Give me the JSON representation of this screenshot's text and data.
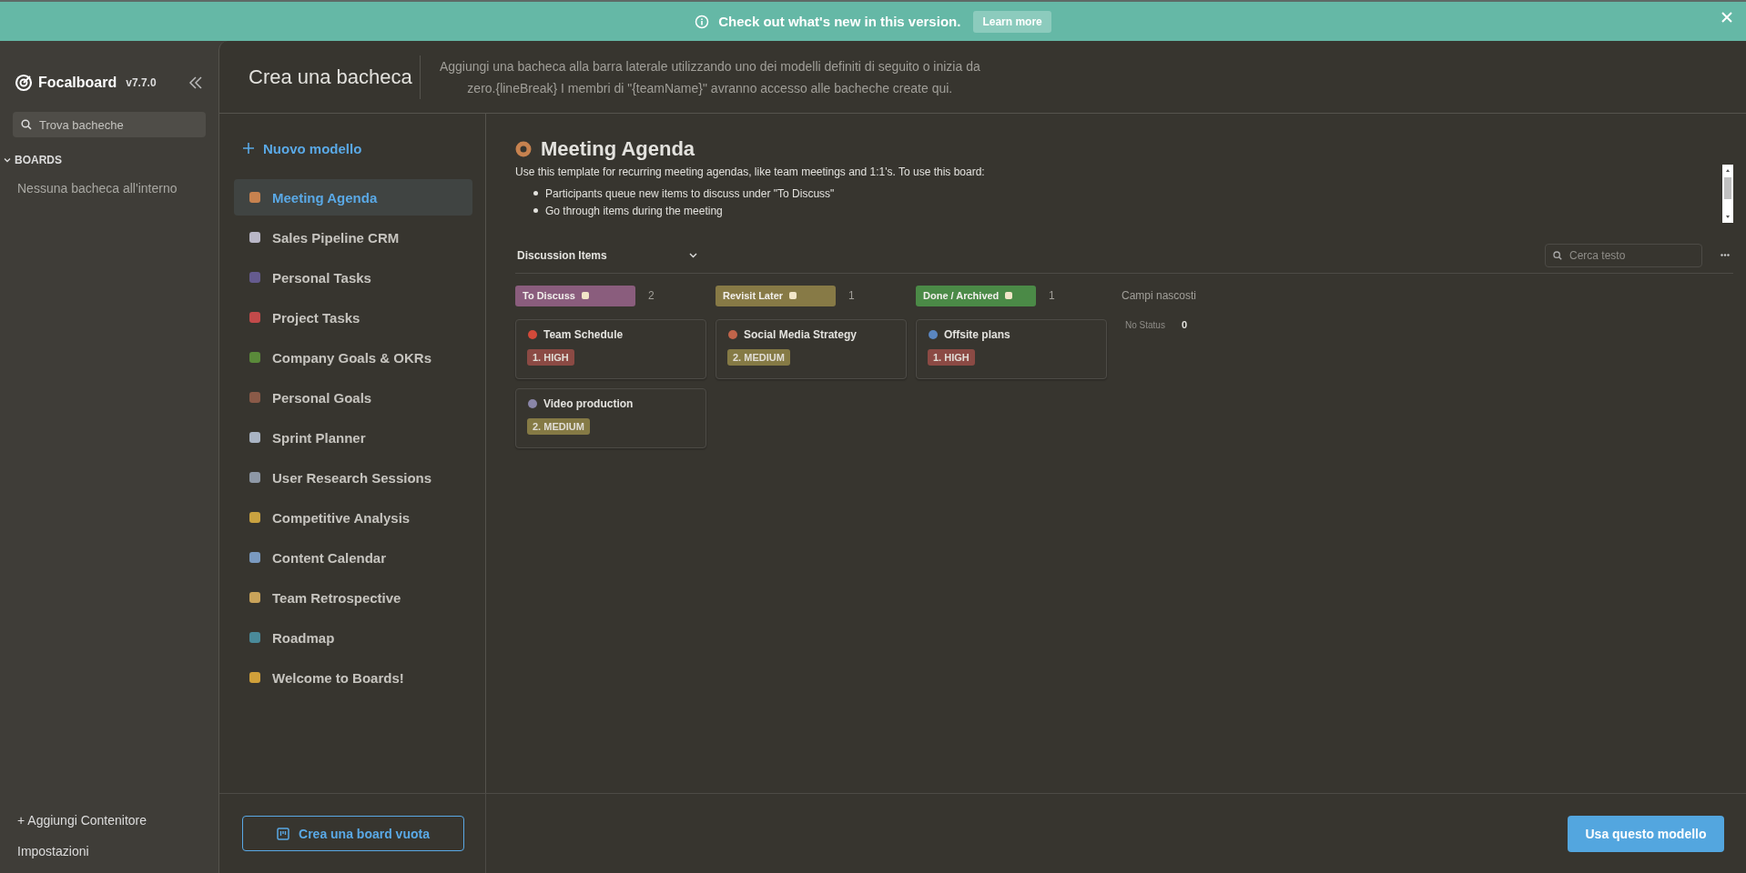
{
  "banner": {
    "message": "Check out what's new in this version.",
    "link": "Learn more"
  },
  "sidebar": {
    "app_name": "Focalboard",
    "version": "v7.7.0",
    "search": {
      "placeholder": "Trova bacheche"
    },
    "section": {
      "label": "BOARDS",
      "expanded": true
    },
    "empty": "Nessuna bacheca all'interno",
    "add": "+ Aggiungi Contenitore",
    "settings": "Impostazioni"
  },
  "dialog": {
    "title": "Crea una bacheca",
    "description": "Aggiungi una bacheca alla barra laterale utilizzando uno dei modelli definiti di seguito o inizia da zero.{lineBreak} I membri di \"{teamName}\" avranno accesso alle bacheche create qui.",
    "new_template": "Nuovo modello",
    "templates": [
      {
        "label": "Meeting Agenda",
        "selected": true
      },
      {
        "label": "Sales Pipeline CRM",
        "selected": false
      },
      {
        "label": "Personal Tasks",
        "selected": false
      },
      {
        "label": "Project Tasks",
        "selected": false
      },
      {
        "label": "Company Goals & OKRs",
        "selected": false
      },
      {
        "label": "Personal Goals",
        "selected": false
      },
      {
        "label": "Sprint Planner",
        "selected": false
      },
      {
        "label": "User Research Sessions",
        "selected": false
      },
      {
        "label": "Competitive Analysis",
        "selected": false
      },
      {
        "label": "Content Calendar",
        "selected": false
      },
      {
        "label": "Team Retrospective",
        "selected": false
      },
      {
        "label": "Roadmap",
        "selected": false
      },
      {
        "label": "Welcome to Boards!",
        "selected": false
      }
    ],
    "preview": {
      "title": "Meeting Agenda",
      "description": "Use this template for recurring meeting agendas, like team meetings and 1:1's. To use this board:",
      "bullets": [
        "Participants queue new items to discuss under \"To Discuss\"",
        "Go through items during the meeting"
      ],
      "view": "Discussion Items",
      "search": {
        "placeholder": "Cerca testo"
      },
      "columns": [
        {
          "label": "To Discuss",
          "color": "#8a5d7d",
          "count": "2",
          "cards": [
            {
              "title": "Team Schedule",
              "priority": "1. HIGH",
              "color": "#8b4a44"
            },
            {
              "title": "Video production",
              "priority": "2. MEDIUM",
              "color": "#857a45"
            }
          ]
        },
        {
          "label": "Revisit Later",
          "color": "#877a46",
          "count": "1",
          "cards": [
            {
              "title": "Social Media Strategy",
              "priority": "2. MEDIUM",
              "color": "#857a45"
            }
          ]
        },
        {
          "label": "Done / Archived",
          "color": "#4b8a47",
          "count": "1",
          "cards": [
            {
              "title": "Offsite plans",
              "priority": "1. HIGH",
              "color": "#8b4a44"
            }
          ]
        }
      ],
      "hidden": {
        "label": "Campi nascosti",
        "items": [
          {
            "label": "No Status",
            "count": "0"
          }
        ]
      }
    }
  },
  "footer": {
    "empty_button": "Crea una board vuota",
    "use_button": "Usa questo modello"
  }
}
